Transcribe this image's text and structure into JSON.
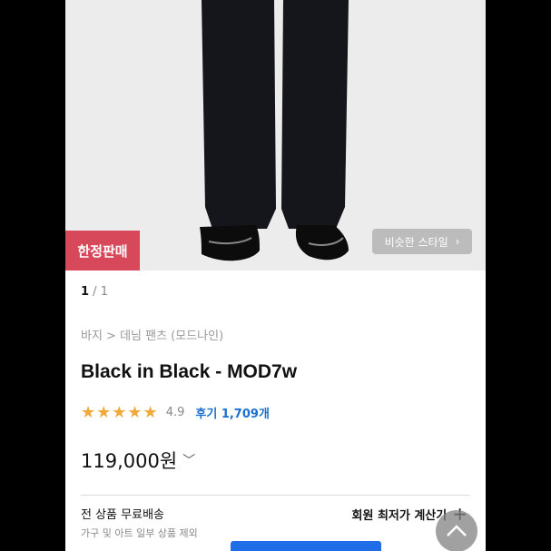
{
  "product": {
    "badge": "한정판매",
    "similar_style": "비슷한 스타일",
    "pager": {
      "current": "1",
      "separator": " / ",
      "total": "1"
    },
    "breadcrumb": "바지 > 데님 팬츠 (모드나인)",
    "title": "Black in Black - MOD7w",
    "rating": {
      "stars": "★★★★★",
      "score": "4.9",
      "reviews": "후기 1,709개"
    },
    "price": "119,000원",
    "shipping": {
      "title": "전 상품 무료배송",
      "note": "가구 및 아트 일부 상품 제외"
    },
    "member_calc": "회원 최저가 계산기"
  },
  "colors": {
    "badge": "#d8485b",
    "star": "#f2a93b",
    "review_link": "#1a6fd1",
    "buy_button": "#1f6ee8"
  },
  "icons": [
    "chevron-right-icon",
    "chevron-down-icon",
    "plus-icon",
    "arrow-up-icon"
  ]
}
